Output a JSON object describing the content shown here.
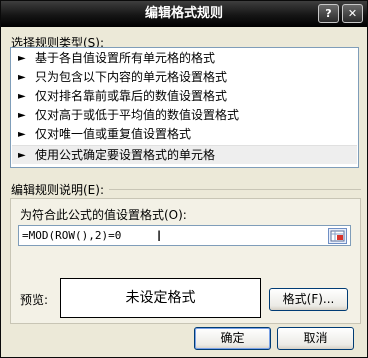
{
  "window": {
    "title": "编辑格式规则",
    "help_glyph": "?",
    "close_glyph": "✕"
  },
  "rule_types": {
    "label": "选择规则类型(S):",
    "items": [
      {
        "arrow": "►",
        "label": "基于各自值设置所有单元格的格式"
      },
      {
        "arrow": "►",
        "label": "只为包含以下内容的单元格设置格式"
      },
      {
        "arrow": "►",
        "label": "仅对排名靠前或靠后的数值设置格式"
      },
      {
        "arrow": "►",
        "label": "仅对高于或低于平均值的数值设置格式"
      },
      {
        "arrow": "►",
        "label": "仅对唯一值或重复值设置格式"
      },
      {
        "arrow": "►",
        "label": "使用公式确定要设置格式的单元格",
        "selected": true
      }
    ]
  },
  "description": {
    "label": "编辑规则说明(E):",
    "formula_label": "为符合此公式的值设置格式(O):",
    "formula_value": "=MOD(ROW(),2)=0",
    "preview_label": "预览:",
    "preview_text": "未设定格式",
    "format_button": "格式(F)..."
  },
  "buttons": {
    "ok": "确定",
    "cancel": "取消"
  }
}
